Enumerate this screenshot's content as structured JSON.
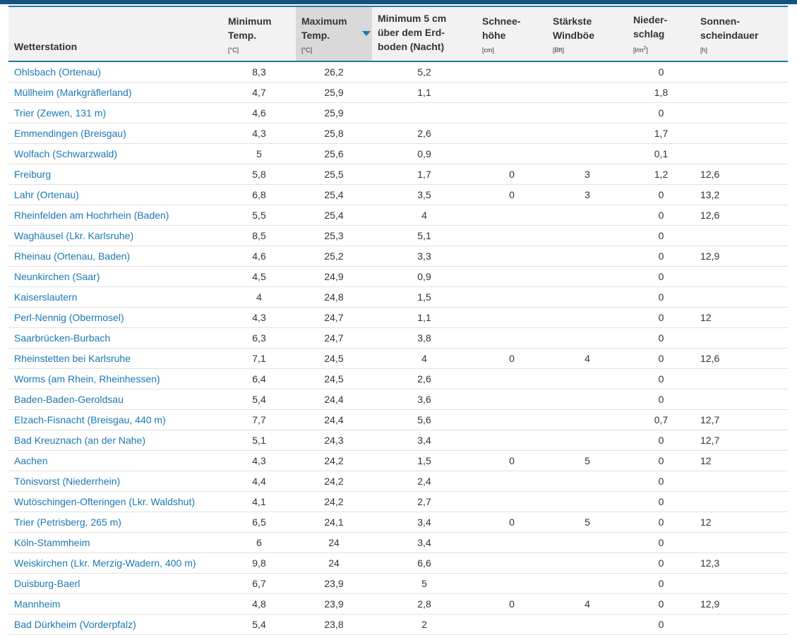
{
  "table": {
    "headers": [
      {
        "label": "Wetterstation",
        "unit": ""
      },
      {
        "label": "Minimum\nTemp.",
        "unit": "[°C]"
      },
      {
        "label": "Maximum\nTemp.",
        "unit": "[°C]",
        "sorted": "descending"
      },
      {
        "label": "Minimum 5 cm\nüber dem Erd-\nboden (Nacht)",
        "unit": ""
      },
      {
        "label": "Schnee-\nhöhe",
        "unit": "[cm]"
      },
      {
        "label": "Stärkste\nWindböe",
        "unit": "[Bft]"
      },
      {
        "label": "Nieder-\nschlag",
        "unit": "[l/m",
        "unit_sup": "2",
        "unit_end": "]"
      },
      {
        "label": "Sonnen-\nscheindauer",
        "unit": "[h]"
      }
    ],
    "rows": [
      [
        "Ohlsbach (Ortenau)",
        "8,3",
        "26,2",
        "5,2",
        "",
        "",
        "0",
        ""
      ],
      [
        "Müllheim (Markgräflerland)",
        "4,7",
        "25,9",
        "1,1",
        "",
        "",
        "1,8",
        ""
      ],
      [
        "Trier (Zewen, 131 m)",
        "4,6",
        "25,9",
        "",
        "",
        "",
        "0",
        ""
      ],
      [
        "Emmendingen (Breisgau)",
        "4,3",
        "25,8",
        "2,6",
        "",
        "",
        "1,7",
        ""
      ],
      [
        "Wolfach (Schwarzwald)",
        "5",
        "25,6",
        "0,9",
        "",
        "",
        "0,1",
        ""
      ],
      [
        "Freiburg",
        "5,8",
        "25,5",
        "1,7",
        "0",
        "3",
        "1,2",
        "12,6"
      ],
      [
        "Lahr (Ortenau)",
        "6,8",
        "25,4",
        "3,5",
        "0",
        "3",
        "0",
        "13,2"
      ],
      [
        "Rheinfelden am Hochrhein (Baden)",
        "5,5",
        "25,4",
        "4",
        "",
        "",
        "0",
        "12,6"
      ],
      [
        "Waghäusel (Lkr. Karlsruhe)",
        "8,5",
        "25,3",
        "5,1",
        "",
        "",
        "0",
        ""
      ],
      [
        "Rheinau (Ortenau, Baden)",
        "4,6",
        "25,2",
        "3,3",
        "",
        "",
        "0",
        "12,9"
      ],
      [
        "Neunkirchen (Saar)",
        "4,5",
        "24,9",
        "0,9",
        "",
        "",
        "0",
        ""
      ],
      [
        "Kaiserslautern",
        "4",
        "24,8",
        "1,5",
        "",
        "",
        "0",
        ""
      ],
      [
        "Perl-Nennig (Obermosel)",
        "4,3",
        "24,7",
        "1,1",
        "",
        "",
        "0",
        "12"
      ],
      [
        "Saarbrücken-Burbach",
        "6,3",
        "24,7",
        "3,8",
        "",
        "",
        "0",
        ""
      ],
      [
        "Rheinstetten bei Karlsruhe",
        "7,1",
        "24,5",
        "4",
        "0",
        "4",
        "0",
        "12,6"
      ],
      [
        "Worms (am Rhein, Rheinhessen)",
        "6,4",
        "24,5",
        "2,6",
        "",
        "",
        "0",
        ""
      ],
      [
        "Baden-Baden-Geroldsau",
        "5,4",
        "24,4",
        "3,6",
        "",
        "",
        "0",
        ""
      ],
      [
        "Elzach-Fisnacht (Breisgau, 440 m)",
        "7,7",
        "24,4",
        "5,6",
        "",
        "",
        "0,7",
        "12,7"
      ],
      [
        "Bad Kreuznach (an der Nahe)",
        "5,1",
        "24,3",
        "3,4",
        "",
        "",
        "0",
        "12,7"
      ],
      [
        "Aachen",
        "4,3",
        "24,2",
        "1,5",
        "0",
        "5",
        "0",
        "12"
      ],
      [
        "Tönisvorst (Niederrhein)",
        "4,4",
        "24,2",
        "2,4",
        "",
        "",
        "0",
        ""
      ],
      [
        "Wutöschingen-Ofteringen (Lkr. Waldshut)",
        "4,1",
        "24,2",
        "2,7",
        "",
        "",
        "0",
        ""
      ],
      [
        "Trier (Petrisberg, 265 m)",
        "6,5",
        "24,1",
        "3,4",
        "0",
        "5",
        "0",
        "12"
      ],
      [
        "Köln-Stammheim",
        "6",
        "24",
        "3,4",
        "",
        "",
        "0",
        ""
      ],
      [
        "Weiskirchen (Lkr. Merzig-Wadern, 400 m)",
        "9,8",
        "24",
        "6,6",
        "",
        "",
        "0",
        "12,3"
      ],
      [
        "Duisburg-Baerl",
        "6,7",
        "23,9",
        "5",
        "",
        "",
        "0",
        ""
      ],
      [
        "Mannheim",
        "4,8",
        "23,9",
        "2,8",
        "0",
        "4",
        "0",
        "12,9"
      ],
      [
        "Bad Dürkheim (Vorderpfalz)",
        "5,4",
        "23,8",
        "2",
        "",
        "",
        "0",
        ""
      ]
    ]
  },
  "colors": {
    "accent": "#1b78b4",
    "header_bg": "#f2f2f2",
    "sorted_header_bg": "#d9d9d9",
    "topbar": "#14537f"
  },
  "icons": {
    "sort": "sort-descending-icon"
  }
}
